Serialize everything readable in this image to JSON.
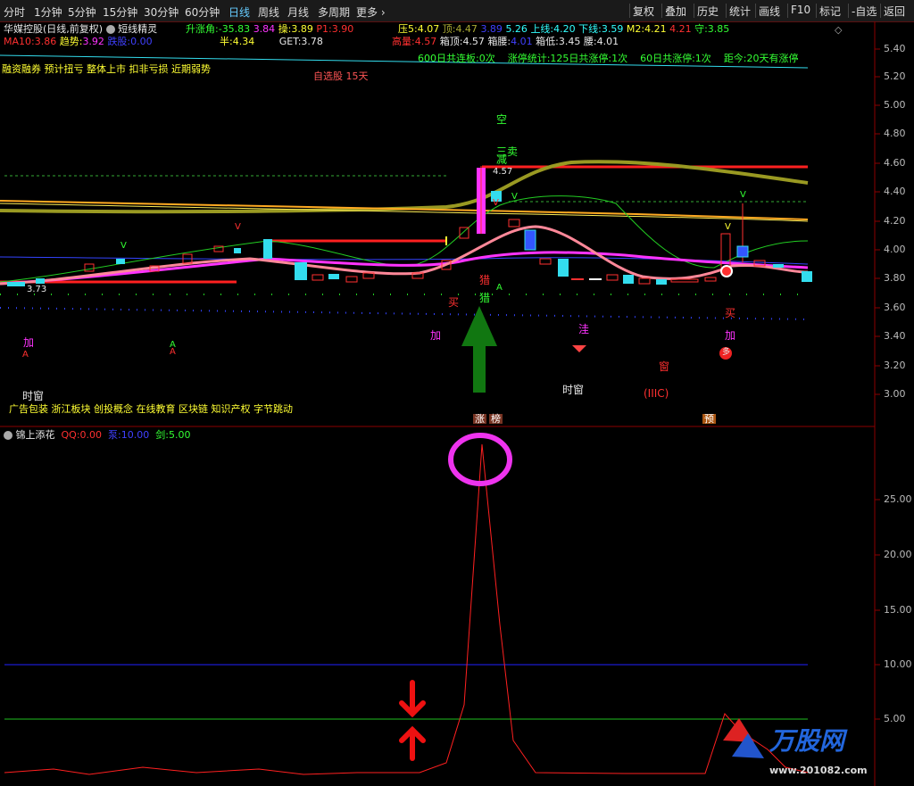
{
  "toolbar": {
    "periods": [
      "分时",
      "1分钟",
      "5分钟",
      "15分钟",
      "30分钟",
      "60分钟",
      "日线",
      "周线",
      "月线",
      "多周期",
      "更多"
    ],
    "active_period": "日线",
    "right_buttons": [
      "复权",
      "叠加",
      "历史",
      "统计",
      "画线",
      "F10",
      "标记",
      "-自选",
      "返回"
    ]
  },
  "main_header": {
    "stock_name": "华媒控股",
    "mode": "(日线,前复权)",
    "indicator": "短线精灵",
    "line1": [
      {
        "label": "升涨角:",
        "value": "-35.83"
      },
      {
        "label": "",
        "value": "3.84"
      },
      {
        "label": "操:",
        "value": "3.89"
      },
      {
        "label": "P1:",
        "value": "3.90"
      },
      {
        "label": "压5:",
        "value": "4.07"
      },
      {
        "label": "顶:",
        "value": "4.47"
      },
      {
        "label": "",
        "value": "3.89"
      },
      {
        "label": "",
        "value": "5.26"
      },
      {
        "label": "上线:",
        "value": "4.20"
      },
      {
        "label": "下线:",
        "value": "3.59"
      },
      {
        "label": "M2:",
        "value": "4.21"
      },
      {
        "label": "",
        "value": "4.21"
      },
      {
        "label": "守:",
        "value": "3.85"
      }
    ],
    "line2": [
      {
        "label": "MA10:",
        "value": "3.86"
      },
      {
        "label": "趋势:",
        "value": "3.92"
      },
      {
        "label": "跌股:",
        "value": "0.00"
      },
      {
        "label": "半:",
        "value": "4.34"
      },
      {
        "label": "GET:",
        "value": "3.78"
      },
      {
        "label": "高量:",
        "value": "4.57"
      },
      {
        "label": "箱顶:",
        "value": "4.57"
      },
      {
        "label": "箱腰:",
        "value": "4.01"
      },
      {
        "label": "箱低:",
        "value": "3.45"
      },
      {
        "label": "腰:",
        "value": "4.01"
      }
    ],
    "stats": [
      "600日共连板:0次",
      "涨停统计:125日共涨停:1次",
      "60日共涨停:1次",
      "距今:20天有涨停"
    ],
    "concepts_top": "融资融券 预计扭亏 整体上市 扣非亏损 近期弱势",
    "watch": "自选股 15天",
    "concepts_bottom": "广告包装 浙江板块 创投概念 在线教育 区块链 知识产权 字节跳动"
  },
  "price_axis": [
    "5.40",
    "5.20",
    "5.00",
    "4.80",
    "4.60",
    "4.40",
    "4.20",
    "4.00",
    "3.80",
    "3.60",
    "3.40",
    "3.20",
    "3.00"
  ],
  "chart_annotations": {
    "high_label": "4.57",
    "low_label": "3.73",
    "signals": [
      "空",
      "三卖",
      "减",
      "猎",
      "买",
      "猎",
      "加",
      "加",
      "洼",
      "买",
      "加",
      "多",
      "窗",
      "(IIIC)",
      "时窗",
      "时窗",
      "A",
      "A",
      "A",
      "A",
      "V",
      "V",
      "V",
      "V",
      "V",
      "V",
      "涨",
      "榜",
      "预"
    ]
  },
  "sub_header": {
    "indicator": "锦上添花",
    "items": [
      {
        "label": "QQ:",
        "value": "0.00"
      },
      {
        "label": "泵:",
        "value": "10.00"
      },
      {
        "label": "剑:",
        "value": "5.00"
      }
    ]
  },
  "sub_axis": [
    "25.00",
    "20.00",
    "15.00",
    "10.00",
    "5.00"
  ],
  "watermark": {
    "brand": "万股网",
    "url": "www.201082.com"
  },
  "colors": {
    "up": "#ff3030",
    "down": "#33ffff",
    "ma_yellow": "#ffff33",
    "ma_magenta": "#ff33ff",
    "qq_line": "#ff2020",
    "blue_line": "#2020ff",
    "green_line": "#20c020"
  }
}
